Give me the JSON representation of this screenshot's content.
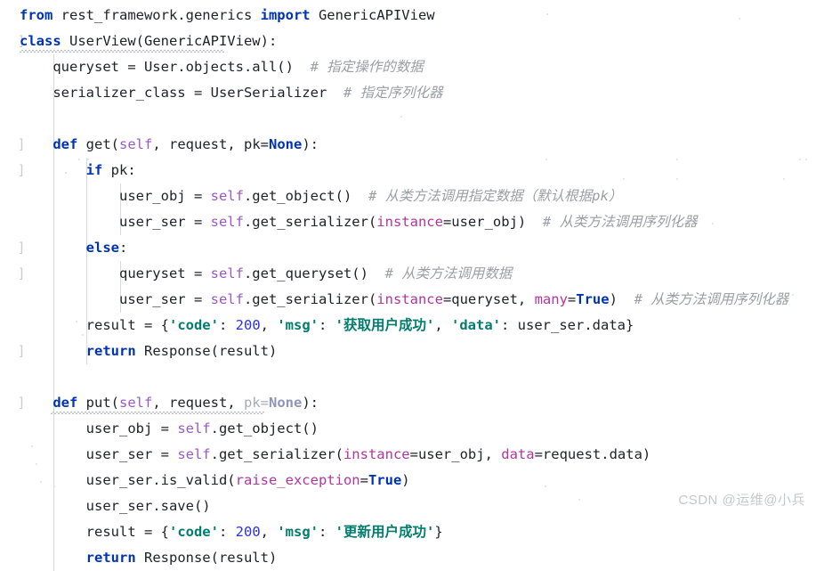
{
  "app": {
    "kind": "code-editor-screenshot",
    "language": "Python",
    "watermark": "CSDN @运维@小兵"
  },
  "theme": {
    "background": "#ffffff",
    "text": "#20232a",
    "keyword": "#0033b3",
    "self_param": "#9b59c6",
    "kwarg": "#b1369e",
    "string": "#017d6e",
    "number": "#2a30ee",
    "comment": "#9a9fa5",
    "dimmed": "#a8adb4",
    "indent_guide": "#d8dade",
    "gutter_marker": "#c9ccd2",
    "watermark": "#c4c7cc"
  },
  "gutter": {
    "fold_marker_glyph": "]",
    "marker_line_indices": [
      1,
      5,
      6,
      9,
      10,
      13,
      15
    ]
  },
  "code": {
    "lines": [
      {
        "index": 0,
        "text": "from rest_framework.generics import GenericAPIView",
        "tokens": [
          {
            "t": "from",
            "c": "kw"
          },
          {
            "t": " rest_framework.generics ",
            "c": "plain"
          },
          {
            "t": "import",
            "c": "kw"
          },
          {
            "t": " GenericAPIView",
            "c": "plain"
          }
        ]
      },
      {
        "index": 1,
        "text": "class UserView(GenericAPIView):",
        "tokens": [
          {
            "t": "class",
            "c": "kw"
          },
          {
            "t": " UserView(GenericAPIView):",
            "c": "plain"
          }
        ]
      },
      {
        "index": 2,
        "text": "    queryset = User.objects.all()  # 指定操作的数据",
        "tokens": [
          {
            "t": "    queryset = User.objects.all()",
            "c": "plain"
          },
          {
            "t": "  # 指定操作的数据",
            "c": "cmt"
          }
        ]
      },
      {
        "index": 3,
        "text": "    serializer_class = UserSerializer  # 指定序列化器",
        "tokens": [
          {
            "t": "    serializer_class = UserSerializer",
            "c": "plain"
          },
          {
            "t": "  # 指定序列化器",
            "c": "cmt"
          }
        ]
      },
      {
        "index": 4,
        "text": "",
        "tokens": []
      },
      {
        "index": 5,
        "text": "    def get(self, request, pk=None):",
        "tokens": [
          {
            "t": "    ",
            "c": "plain"
          },
          {
            "t": "def",
            "c": "kw"
          },
          {
            "t": " get(",
            "c": "plain"
          },
          {
            "t": "self",
            "c": "self"
          },
          {
            "t": ", request, ",
            "c": "plain"
          },
          {
            "t": "pk=",
            "c": "plain"
          },
          {
            "t": "None",
            "c": "kw"
          },
          {
            "t": "):",
            "c": "plain"
          }
        ]
      },
      {
        "index": 6,
        "text": "        if pk:",
        "tokens": [
          {
            "t": "        ",
            "c": "plain"
          },
          {
            "t": "if",
            "c": "kw"
          },
          {
            "t": " pk:",
            "c": "plain"
          }
        ]
      },
      {
        "index": 7,
        "text": "            user_obj = self.get_object()  # 从类方法调用指定数据（默认根据pk）",
        "tokens": [
          {
            "t": "            user_obj = ",
            "c": "plain"
          },
          {
            "t": "self",
            "c": "self"
          },
          {
            "t": ".get_object()",
            "c": "plain"
          },
          {
            "t": "  # 从类方法调用指定数据（默认根据pk）",
            "c": "cmt"
          }
        ]
      },
      {
        "index": 8,
        "text": "            user_ser = self.get_serializer(instance=user_obj)  # 从类方法调用序列化器",
        "tokens": [
          {
            "t": "            user_ser = ",
            "c": "plain"
          },
          {
            "t": "self",
            "c": "self"
          },
          {
            "t": ".get_serializer(",
            "c": "plain"
          },
          {
            "t": "instance",
            "c": "kwarg"
          },
          {
            "t": "=user_obj)",
            "c": "plain"
          },
          {
            "t": "  # 从类方法调用序列化器",
            "c": "cmt"
          }
        ]
      },
      {
        "index": 9,
        "text": "        else:",
        "tokens": [
          {
            "t": "        ",
            "c": "plain"
          },
          {
            "t": "else",
            "c": "kw"
          },
          {
            "t": ":",
            "c": "plain"
          }
        ]
      },
      {
        "index": 10,
        "text": "            queryset = self.get_queryset()  # 从类方法调用数据",
        "tokens": [
          {
            "t": "            queryset = ",
            "c": "plain"
          },
          {
            "t": "self",
            "c": "self"
          },
          {
            "t": ".get_queryset()",
            "c": "plain"
          },
          {
            "t": "  # 从类方法调用数据",
            "c": "cmt"
          }
        ]
      },
      {
        "index": 11,
        "text": "            user_ser = self.get_serializer(instance=queryset, many=True)  # 从类方法调用序列化器",
        "tokens": [
          {
            "t": "            user_ser = ",
            "c": "plain"
          },
          {
            "t": "self",
            "c": "self"
          },
          {
            "t": ".get_serializer(",
            "c": "plain"
          },
          {
            "t": "instance",
            "c": "kwarg"
          },
          {
            "t": "=queryset, ",
            "c": "plain"
          },
          {
            "t": "many",
            "c": "kwarg"
          },
          {
            "t": "=",
            "c": "plain"
          },
          {
            "t": "True",
            "c": "kw"
          },
          {
            "t": ")",
            "c": "plain"
          },
          {
            "t": "  # 从类方法调用序列化器",
            "c": "cmt"
          }
        ]
      },
      {
        "index": 12,
        "text": "        result = {'code': 200, 'msg': '获取用户成功', 'data': user_ser.data}",
        "tokens": [
          {
            "t": "        result = {",
            "c": "plain"
          },
          {
            "t": "'code'",
            "c": "str"
          },
          {
            "t": ": ",
            "c": "plain"
          },
          {
            "t": "200",
            "c": "num"
          },
          {
            "t": ", ",
            "c": "plain"
          },
          {
            "t": "'msg'",
            "c": "str"
          },
          {
            "t": ": ",
            "c": "plain"
          },
          {
            "t": "'获取用户成功'",
            "c": "str"
          },
          {
            "t": ", ",
            "c": "plain"
          },
          {
            "t": "'data'",
            "c": "str"
          },
          {
            "t": ": user_ser.data}",
            "c": "plain"
          }
        ]
      },
      {
        "index": 13,
        "text": "        return Response(result)",
        "tokens": [
          {
            "t": "        ",
            "c": "plain"
          },
          {
            "t": "return",
            "c": "kw"
          },
          {
            "t": " Response(result)",
            "c": "plain"
          }
        ]
      },
      {
        "index": 14,
        "text": "",
        "tokens": []
      },
      {
        "index": 15,
        "text": "    def put(self, request, pk=None):",
        "tokens": [
          {
            "t": "    ",
            "c": "plain"
          },
          {
            "t": "def",
            "c": "kw"
          },
          {
            "t": " put(",
            "c": "plain"
          },
          {
            "t": "self",
            "c": "self"
          },
          {
            "t": ", request, ",
            "c": "plain"
          },
          {
            "t": "pk=",
            "c": "dim"
          },
          {
            "t": "None",
            "c": "dimkw"
          },
          {
            "t": "):",
            "c": "plain"
          }
        ]
      },
      {
        "index": 16,
        "text": "        user_obj = self.get_object()",
        "tokens": [
          {
            "t": "        user_obj = ",
            "c": "plain"
          },
          {
            "t": "self",
            "c": "self"
          },
          {
            "t": ".get_object()",
            "c": "plain"
          }
        ]
      },
      {
        "index": 17,
        "text": "        user_ser = self.get_serializer(instance=user_obj, data=request.data)",
        "tokens": [
          {
            "t": "        user_ser = ",
            "c": "plain"
          },
          {
            "t": "self",
            "c": "self"
          },
          {
            "t": ".get_serializer(",
            "c": "plain"
          },
          {
            "t": "instance",
            "c": "kwarg"
          },
          {
            "t": "=user_obj, ",
            "c": "plain"
          },
          {
            "t": "data",
            "c": "kwarg"
          },
          {
            "t": "=request.data)",
            "c": "plain"
          }
        ]
      },
      {
        "index": 18,
        "text": "        user_ser.is_valid(raise_exception=True)",
        "tokens": [
          {
            "t": "        user_ser.is_valid(",
            "c": "plain"
          },
          {
            "t": "raise_exception",
            "c": "kwarg"
          },
          {
            "t": "=",
            "c": "plain"
          },
          {
            "t": "True",
            "c": "kw"
          },
          {
            "t": ")",
            "c": "plain"
          }
        ]
      },
      {
        "index": 19,
        "text": "        user_ser.save()",
        "tokens": [
          {
            "t": "        user_ser.save()",
            "c": "plain"
          }
        ]
      },
      {
        "index": 20,
        "text": "        result = {'code': 200, 'msg': '更新用户成功'}",
        "tokens": [
          {
            "t": "        result = {",
            "c": "plain"
          },
          {
            "t": "'code'",
            "c": "str"
          },
          {
            "t": ": ",
            "c": "plain"
          },
          {
            "t": "200",
            "c": "num"
          },
          {
            "t": ", ",
            "c": "plain"
          },
          {
            "t": "'msg'",
            "c": "str"
          },
          {
            "t": ": ",
            "c": "plain"
          },
          {
            "t": "'更新用户成功'",
            "c": "str"
          },
          {
            "t": "}",
            "c": "plain"
          }
        ]
      },
      {
        "index": 21,
        "text": "        return Response(result)",
        "tokens": [
          {
            "t": "        ",
            "c": "plain"
          },
          {
            "t": "return",
            "c": "kw"
          },
          {
            "t": " Response(result)",
            "c": "plain"
          }
        ]
      }
    ]
  }
}
